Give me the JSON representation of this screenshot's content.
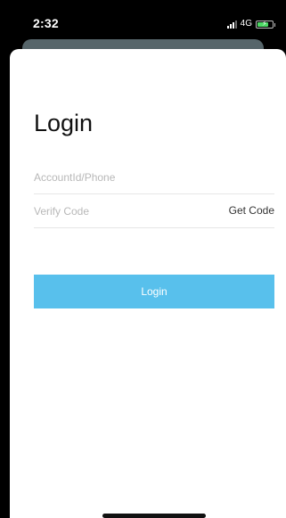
{
  "status_bar": {
    "time": "2:32",
    "network": "4G",
    "battery_level": 0.75,
    "battery_color": "#4cd964"
  },
  "login": {
    "title": "Login",
    "account_placeholder": "AccountId/Phone",
    "code_placeholder": "Verify Code",
    "get_code_label": "Get Code",
    "login_button_label": "Login",
    "button_color": "#58c0ec"
  }
}
